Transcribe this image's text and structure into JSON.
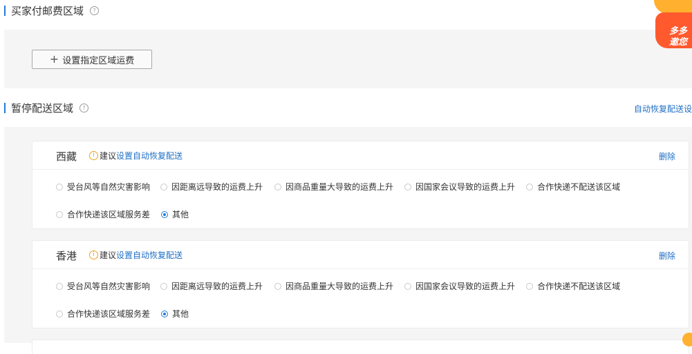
{
  "buyer_pays_section": {
    "title": "买家付邮费区域",
    "help_icon": "question-icon",
    "add_button_label": "设置指定区域运费",
    "add_icon": "plus-icon"
  },
  "paused_section": {
    "title": "暂停配送区域",
    "help_icon": "question-icon",
    "auto_restore_link": "自动恢复配送设",
    "cards": [
      {
        "region": "西藏",
        "tip_prefix": "建议",
        "tip_link": "设置自动恢复配送",
        "delete_label": "删除",
        "reasons_row1": [
          "受台风等自然灾害影响",
          "因距离远导致的运费上升",
          "因商品重量大导致的运费上升",
          "因国家会议导致的运费上升",
          "合作快递不配送该区域"
        ],
        "reasons_row2": [
          "合作快递该区域服务差",
          "其他"
        ],
        "selected": "其他"
      },
      {
        "region": "香港",
        "tip_prefix": "建议",
        "tip_link": "设置自动恢复配送",
        "delete_label": "删除",
        "reasons_row1": [
          "受台风等自然灾害影响",
          "因距离远导致的运费上升",
          "因商品重量大导致的运费上升",
          "因国家会议导致的运费上升",
          "合作快递不配送该区域"
        ],
        "reasons_row2": [
          "合作快递该区域服务差",
          "其他"
        ],
        "selected": "其他"
      }
    ]
  },
  "promo": {
    "line1": "多多",
    "line2": "邀您"
  },
  "colors": {
    "accent": "#1f7bdc",
    "link": "#1f6fc5",
    "warning": "#f0a020",
    "panel_bg": "#f5f5f5"
  }
}
